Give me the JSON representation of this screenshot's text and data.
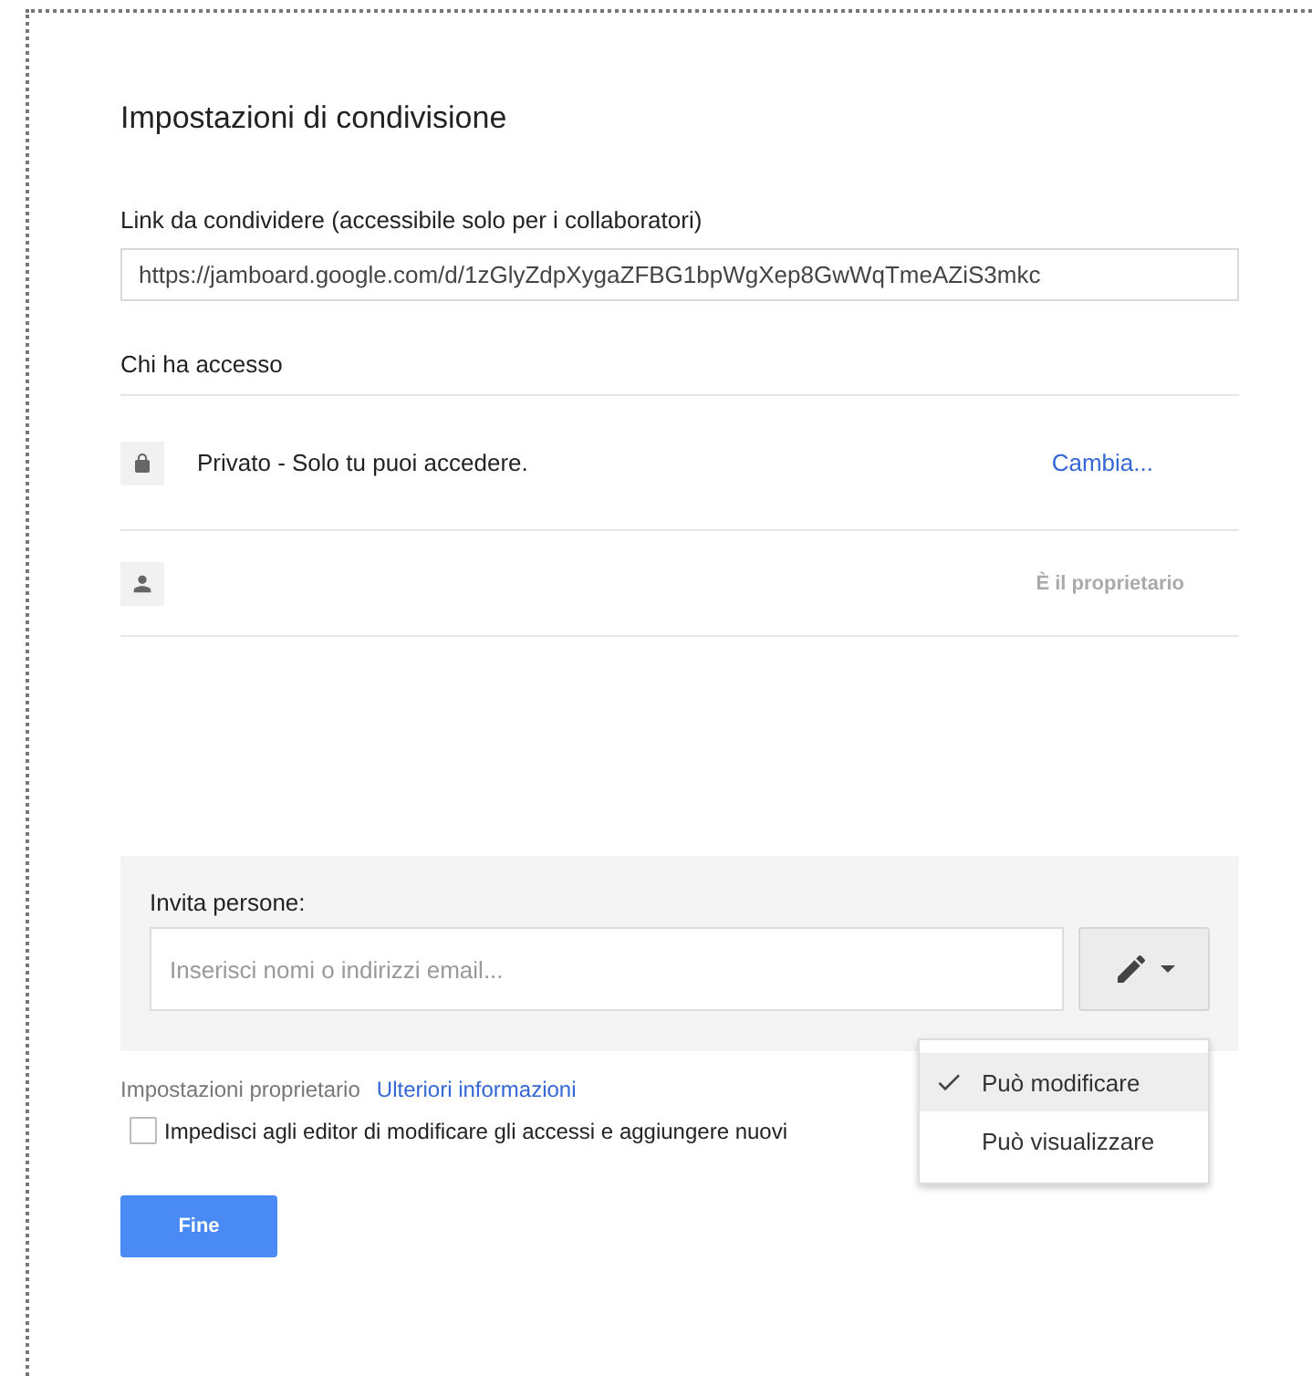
{
  "title": "Impostazioni di condivisione",
  "link": {
    "label": "Link da condividere (accessibile solo per i collaboratori)",
    "value": "https://jamboard.google.com/d/1zGlyZdpXygaZFBG1bpWgXep8GwWqTmeAZiS3mkc"
  },
  "access": {
    "heading": "Chi ha accesso",
    "rows": [
      {
        "kind": "visibility",
        "text": "Privato - Solo tu puoi accedere.",
        "action": "Cambia..."
      },
      {
        "kind": "person",
        "role": "È il proprietario"
      }
    ]
  },
  "invite": {
    "label": "Invita persone:",
    "placeholder": "Inserisci nomi o indirizzi email...",
    "menu": [
      {
        "label": "Può modificare",
        "selected": true
      },
      {
        "label": "Può visualizzare",
        "selected": false
      }
    ]
  },
  "owner_settings": {
    "label": "Impostazioni proprietario",
    "link": "Ulteriori informazioni",
    "checkbox": {
      "label": "Impedisci agli editor di modificare gli accessi e aggiungere nuovi",
      "checked": false
    }
  },
  "done_button": "Fine"
}
